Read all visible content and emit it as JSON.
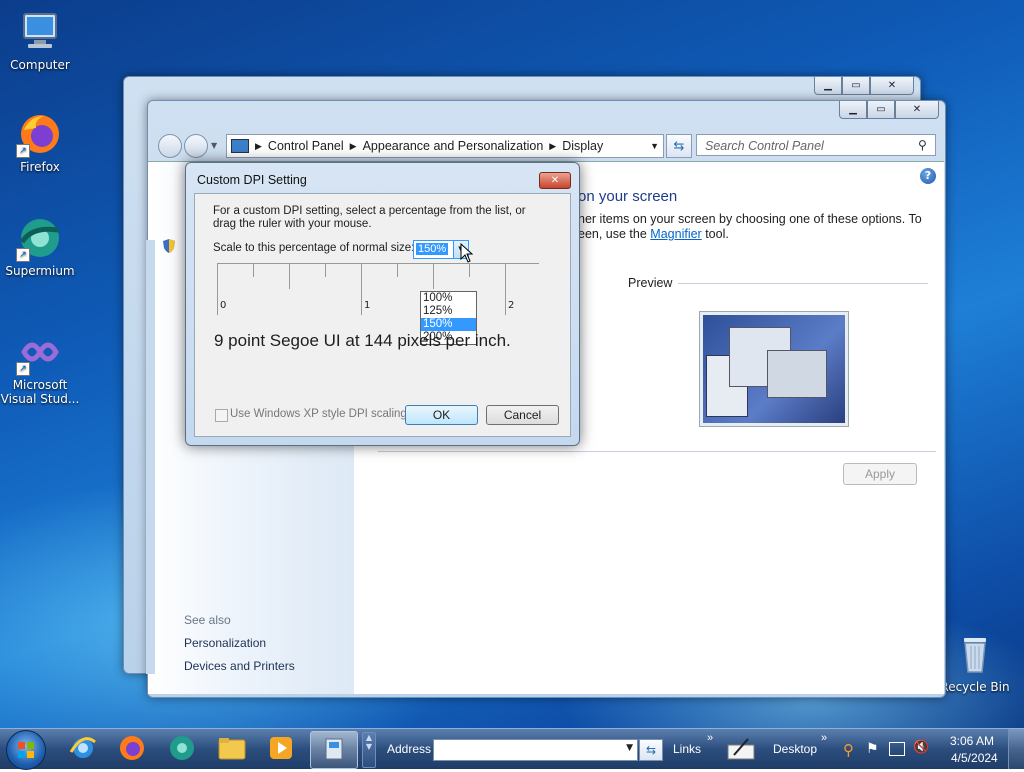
{
  "desktop": {
    "icons": [
      {
        "label": "Computer"
      },
      {
        "label": "Firefox"
      },
      {
        "label": "Supermium"
      },
      {
        "label": "Microsoft Visual Stud..."
      },
      {
        "label": "Recycle Bin"
      }
    ]
  },
  "control_panel": {
    "breadcrumb": [
      "Control Panel",
      "Appearance and Personalization",
      "Display"
    ],
    "search_placeholder": "Search Control Panel",
    "heading_fragment": "on your screen",
    "body_line1": "her items on your screen by choosing one of these options. To",
    "body_line2_pre": "een, use the",
    "magnifier_link": "Magnifier",
    "body_line2_post": "tool.",
    "preview_label": "Preview",
    "apply_label": "Apply",
    "see_also": "See also",
    "see_also_links": [
      "Personalization",
      "Devices and Printers"
    ]
  },
  "dpi_dialog": {
    "title": "Custom DPI Setting",
    "instructions_line1": "For a custom DPI setting, select a percentage from the list, or",
    "instructions_line2": "drag the ruler with your mouse.",
    "scale_label": "Scale to this percentage of normal size:",
    "scale_value": "150%",
    "scale_options": [
      "100%",
      "125%",
      "150%",
      "200%"
    ],
    "ruler_labels": [
      "0",
      "1",
      "2"
    ],
    "sample_text": "9 point Segoe UI at 144 pixels per inch.",
    "xp_checkbox_label": "Use Windows XP style DPI scaling",
    "ok_label": "OK",
    "cancel_label": "Cancel"
  },
  "taskbar": {
    "address_label": "Address",
    "links_label": "Links",
    "desktop_label": "Desktop",
    "time": "3:06 AM",
    "date": "4/5/2024"
  }
}
